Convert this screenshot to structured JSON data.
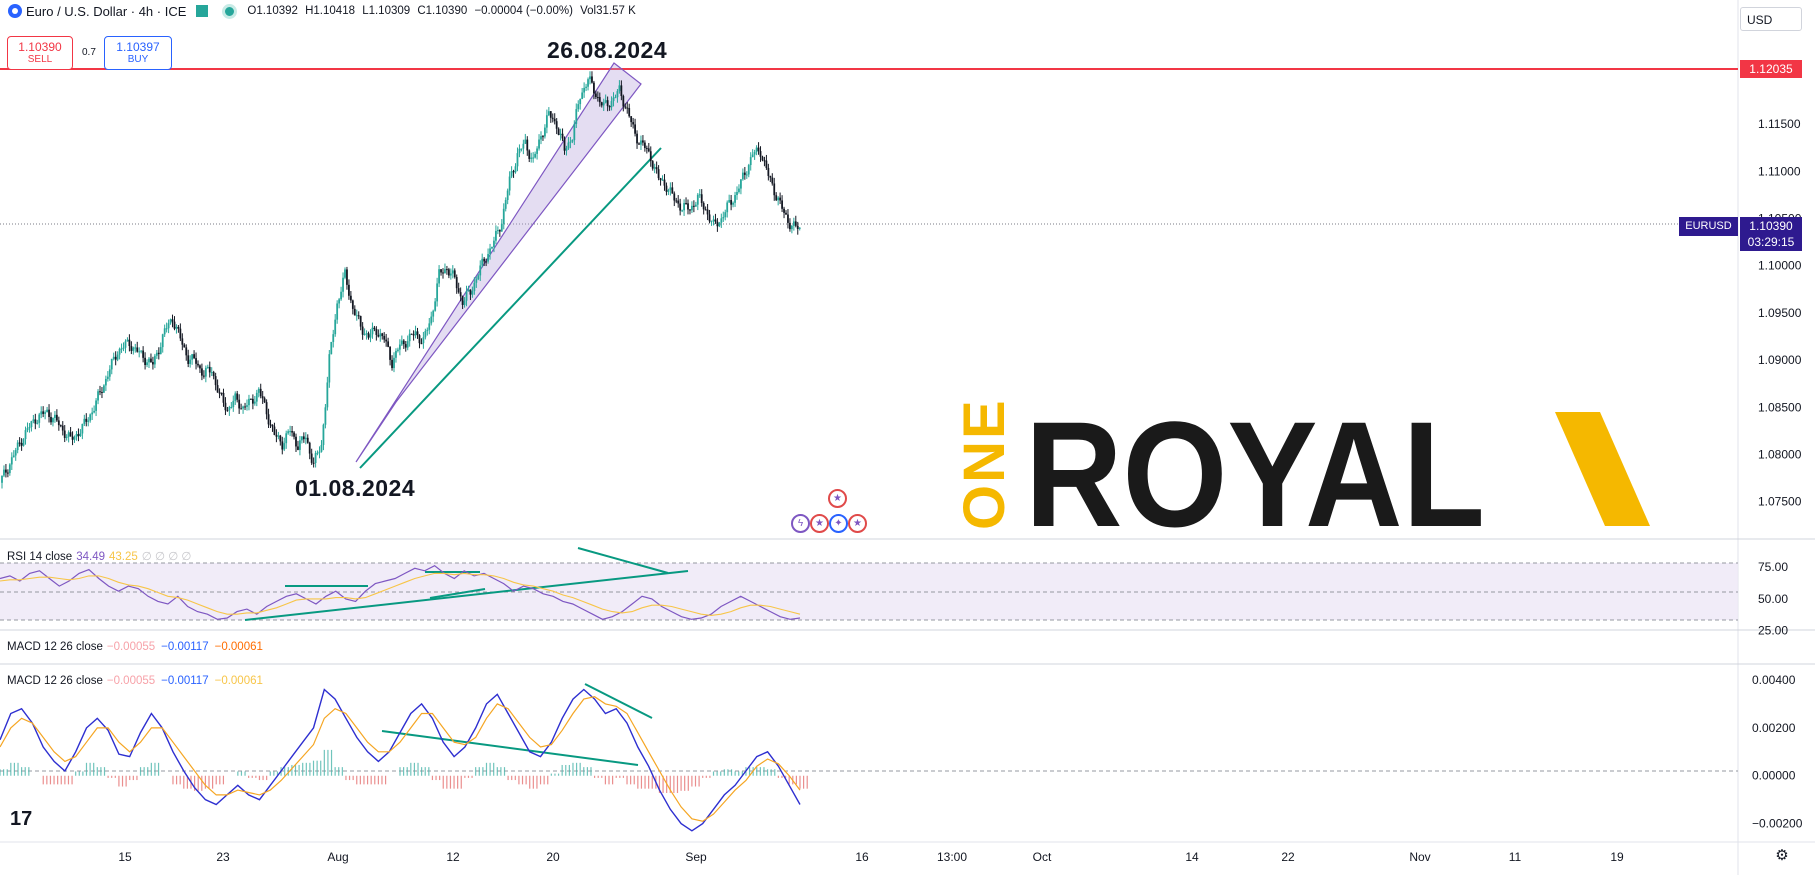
{
  "header": {
    "symbol": "Euro / U.S. Dollar · 4h · ICE",
    "open": "O1.10392",
    "high": "H1.10418",
    "low": "L1.10309",
    "close": "C1.10390",
    "change": "−0.00004 (−0.00%)",
    "volume": "Vol31.57 K",
    "currency": "USD"
  },
  "trade": {
    "sell_price": "1.10390",
    "sell_label": "SELL",
    "spread": "0.7",
    "buy_price": "1.10397",
    "buy_label": "BUY"
  },
  "annotations": {
    "peak_date": "26.08.2024",
    "trough_date": "01.08.2024"
  },
  "price_tags": {
    "resistance": "1.12035",
    "symbol": "EURUSD",
    "last": "1.10390",
    "countdown": "03:29:15"
  },
  "rsi_label": {
    "name": "RSI 14 close",
    "v1": "34.49",
    "v2": "43.25",
    "v3": "∅ ∅ ∅ ∅"
  },
  "macd_label_1": {
    "name": "MACD 12 26 close",
    "v1": "−0.00055",
    "v2": "−0.00117",
    "v3": "−0.00061"
  },
  "macd_label_2": {
    "name": "MACD 12 26 close",
    "v1": "−0.00055",
    "v2": "−0.00117",
    "v3": "−0.00061"
  },
  "brand": {
    "word1": "ONE",
    "word2": "ROYAL"
  },
  "colors": {
    "up": "#26a69a",
    "down": "#131722",
    "resistance": "#f23645",
    "trendline": "#089981",
    "channel": "#7e57c2",
    "rsi": "#7e57c2",
    "rsi_ma": "#f7c548",
    "macd": "#2e2fd0",
    "signal": "#f5a623",
    "brand_yellow": "#f5b800"
  },
  "chart_data": [
    {
      "type": "candlestick",
      "title": "Euro / U.S. Dollar · 4h · ICE",
      "x_tick_labels": [
        "15",
        "23",
        "Aug",
        "12",
        "20",
        "Sep",
        "16",
        "13:00",
        "Oct",
        "14",
        "22",
        "Nov",
        "11",
        "19"
      ],
      "y_tick_labels": [
        "1.11500",
        "1.11000",
        "1.10500",
        "1.10000",
        "1.09500",
        "1.09000",
        "1.08500",
        "1.08000",
        "1.07500"
      ],
      "ylim": [
        1.072,
        1.1255
      ],
      "horizontal_line": 1.12035,
      "last_price": 1.1039,
      "close_path": [
        [
          0,
          1.077
        ],
        [
          6,
          1.0795
        ],
        [
          12,
          1.082
        ],
        [
          18,
          1.0838
        ],
        [
          24,
          1.0845
        ],
        [
          30,
          1.0832
        ],
        [
          36,
          1.0815
        ],
        [
          42,
          1.0828
        ],
        [
          48,
          1.085
        ],
        [
          54,
          1.088
        ],
        [
          60,
          1.091
        ],
        [
          66,
          1.0918
        ],
        [
          72,
          1.0905
        ],
        [
          78,
          1.0895
        ],
        [
          84,
          1.093
        ],
        [
          88,
          1.0945
        ],
        [
          92,
          1.0922
        ],
        [
          96,
          1.0902
        ],
        [
          100,
          1.0898
        ],
        [
          104,
          1.0885
        ],
        [
          108,
          1.089
        ],
        [
          112,
          1.0862
        ],
        [
          116,
          1.0848
        ],
        [
          120,
          1.0858
        ],
        [
          124,
          1.085
        ],
        [
          128,
          1.0855
        ],
        [
          132,
          1.0868
        ],
        [
          136,
          1.0845
        ],
        [
          140,
          1.082
        ],
        [
          144,
          1.0812
        ],
        [
          148,
          1.0825
        ],
        [
          152,
          1.081
        ],
        [
          156,
          1.0818
        ],
        [
          160,
          1.079
        ],
        [
          164,
          1.081
        ],
        [
          168,
          1.09
        ],
        [
          172,
          1.096
        ],
        [
          176,
          1.099
        ],
        [
          180,
          1.0955
        ],
        [
          184,
          1.0935
        ],
        [
          188,
          1.0925
        ],
        [
          192,
          1.0932
        ],
        [
          196,
          1.0922
        ],
        [
          200,
          1.0898
        ],
        [
          204,
          1.0915
        ],
        [
          208,
          1.0922
        ],
        [
          212,
          1.0928
        ],
        [
          216,
          1.092
        ],
        [
          220,
          1.0945
        ],
        [
          224,
          1.099
        ],
        [
          228,
          1.0998
        ],
        [
          232,
          1.0985
        ],
        [
          236,
          1.0962
        ],
        [
          240,
          1.0972
        ],
        [
          244,
          1.0992
        ],
        [
          248,
          1.101
        ],
        [
          252,
          1.1025
        ],
        [
          256,
          1.1048
        ],
        [
          260,
          1.109
        ],
        [
          264,
          1.1118
        ],
        [
          268,
          1.113
        ],
        [
          272,
          1.111
        ],
        [
          276,
          1.1138
        ],
        [
          280,
          1.116
        ],
        [
          284,
          1.115
        ],
        [
          288,
          1.1122
        ],
        [
          292,
          1.1138
        ],
        [
          296,
          1.118
        ],
        [
          300,
          1.1198
        ],
        [
          304,
          1.1182
        ],
        [
          308,
          1.1168
        ],
        [
          312,
          1.1175
        ],
        [
          316,
          1.1185
        ],
        [
          320,
          1.1165
        ],
        [
          324,
          1.1138
        ],
        [
          328,
          1.1128
        ],
        [
          332,
          1.1115
        ],
        [
          336,
          1.1092
        ],
        [
          340,
          1.1085
        ],
        [
          344,
          1.107
        ],
        [
          348,
          1.1062
        ],
        [
          352,
          1.106
        ],
        [
          356,
          1.1072
        ],
        [
          360,
          1.106
        ],
        [
          364,
          1.1042
        ],
        [
          368,
          1.105
        ],
        [
          372,
          1.1065
        ],
        [
          376,
          1.1078
        ],
        [
          380,
          1.1098
        ],
        [
          384,
          1.1118
        ],
        [
          388,
          1.1122
        ],
        [
          392,
          1.1095
        ],
        [
          396,
          1.1075
        ],
        [
          400,
          1.1055
        ],
        [
          404,
          1.1042
        ],
        [
          408,
          1.1039
        ]
      ]
    },
    {
      "type": "line",
      "title": "RSI 14 close",
      "y_tick_labels": [
        "75.00",
        "50.00",
        "25.00"
      ],
      "ylim": [
        24,
        86
      ],
      "bands": [
        30,
        50,
        70
      ],
      "series": [
        {
          "name": "RSI 14 close",
          "values": [
            66,
            68,
            64,
            70,
            72,
            66,
            60,
            64,
            70,
            73,
            66,
            60,
            56,
            60,
            58,
            52,
            48,
            46,
            52,
            44,
            40,
            38,
            34,
            35,
            40,
            42,
            38,
            44,
            48,
            52,
            54,
            50,
            46,
            52,
            56,
            50,
            48,
            56,
            62,
            64,
            66,
            70,
            74,
            72,
            76,
            70,
            66,
            72,
            68,
            70,
            66,
            62,
            56,
            60,
            58,
            54,
            52,
            48,
            46,
            42,
            38,
            34,
            36,
            40,
            46,
            52,
            50,
            44,
            40,
            36,
            34,
            35,
            38,
            44,
            48,
            52,
            48,
            44,
            40,
            36,
            34,
            35
          ]
        },
        {
          "name": "43.25",
          "values": [
            64,
            65,
            65,
            66,
            67,
            67,
            66,
            65,
            66,
            68,
            68,
            66,
            63,
            61,
            60,
            58,
            55,
            52,
            51,
            49,
            46,
            43,
            40,
            38,
            38,
            39,
            39,
            41,
            43,
            46,
            49,
            50,
            50,
            50,
            51,
            51,
            50,
            51,
            54,
            57,
            60,
            63,
            66,
            68,
            70,
            70,
            69,
            70,
            69,
            69,
            68,
            66,
            63,
            61,
            60,
            58,
            56,
            53,
            51,
            48,
            45,
            42,
            40,
            39,
            40,
            43,
            45,
            45,
            44,
            42,
            40,
            38,
            37,
            38,
            40,
            43,
            45,
            45,
            44,
            42,
            40,
            38
          ]
        }
      ]
    },
    {
      "type": "line",
      "title": "MACD 12 26 close",
      "y_tick_labels": [
        "0.00400",
        "0.00200",
        "0.00000",
        "-0.00200"
      ],
      "ylim": [
        -0.0026,
        0.0045
      ],
      "series": [
        {
          "name": "−0.00117",
          "values": [
            0.0015,
            0.0026,
            0.0028,
            0.0022,
            0.0012,
            0.0006,
            0.0002,
            0.001,
            0.002,
            0.0024,
            0.0019,
            0.0009,
            0.0008,
            0.0018,
            0.0026,
            0.002,
            0.001,
            0.0002,
            -0.0005,
            -0.001,
            -0.0012,
            -0.0008,
            -0.0004,
            -0.0008,
            -0.001,
            -0.0004,
            0.0002,
            0.0008,
            0.0014,
            0.002,
            0.0036,
            0.0032,
            0.0024,
            0.0016,
            0.001,
            0.0006,
            0.001,
            0.0018,
            0.0026,
            0.003,
            0.0024,
            0.0014,
            0.0008,
            0.0012,
            0.002,
            0.003,
            0.0034,
            0.0026,
            0.0018,
            0.001,
            0.0008,
            0.0014,
            0.0024,
            0.0032,
            0.0036,
            0.0032,
            0.0026,
            0.0028,
            0.0022,
            0.0012,
            0.0004,
            -0.0006,
            -0.0014,
            -0.002,
            -0.0023,
            -0.002,
            -0.0014,
            -0.0008,
            -0.0004,
            0.0002,
            0.0008,
            0.001,
            0.0004,
            -0.0004,
            -0.0012
          ]
        },
        {
          "name": "−0.00061",
          "values": [
            0.0012,
            0.002,
            0.0024,
            0.0022,
            0.0016,
            0.001,
            0.0006,
            0.0008,
            0.0014,
            0.002,
            0.002,
            0.0014,
            0.001,
            0.0014,
            0.002,
            0.002,
            0.0014,
            0.0008,
            0.0002,
            -0.0004,
            -0.0008,
            -0.0008,
            -0.0006,
            -0.0007,
            -0.0008,
            -0.0006,
            -0.0002,
            0.0003,
            0.0008,
            0.0013,
            0.0024,
            0.0028,
            0.0026,
            0.002,
            0.0014,
            0.001,
            0.001,
            0.0014,
            0.002,
            0.0026,
            0.0026,
            0.002,
            0.0014,
            0.0013,
            0.0016,
            0.0024,
            0.003,
            0.0028,
            0.0022,
            0.0016,
            0.0012,
            0.0013,
            0.0019,
            0.0026,
            0.0032,
            0.0033,
            0.003,
            0.0029,
            0.0026,
            0.0018,
            0.001,
            0.0002,
            -0.0006,
            -0.0013,
            -0.0018,
            -0.0019,
            -0.0016,
            -0.0011,
            -0.0006,
            -0.0002,
            0.0004,
            0.0007,
            0.0005,
            0.0,
            -0.0006
          ]
        }
      ]
    }
  ]
}
